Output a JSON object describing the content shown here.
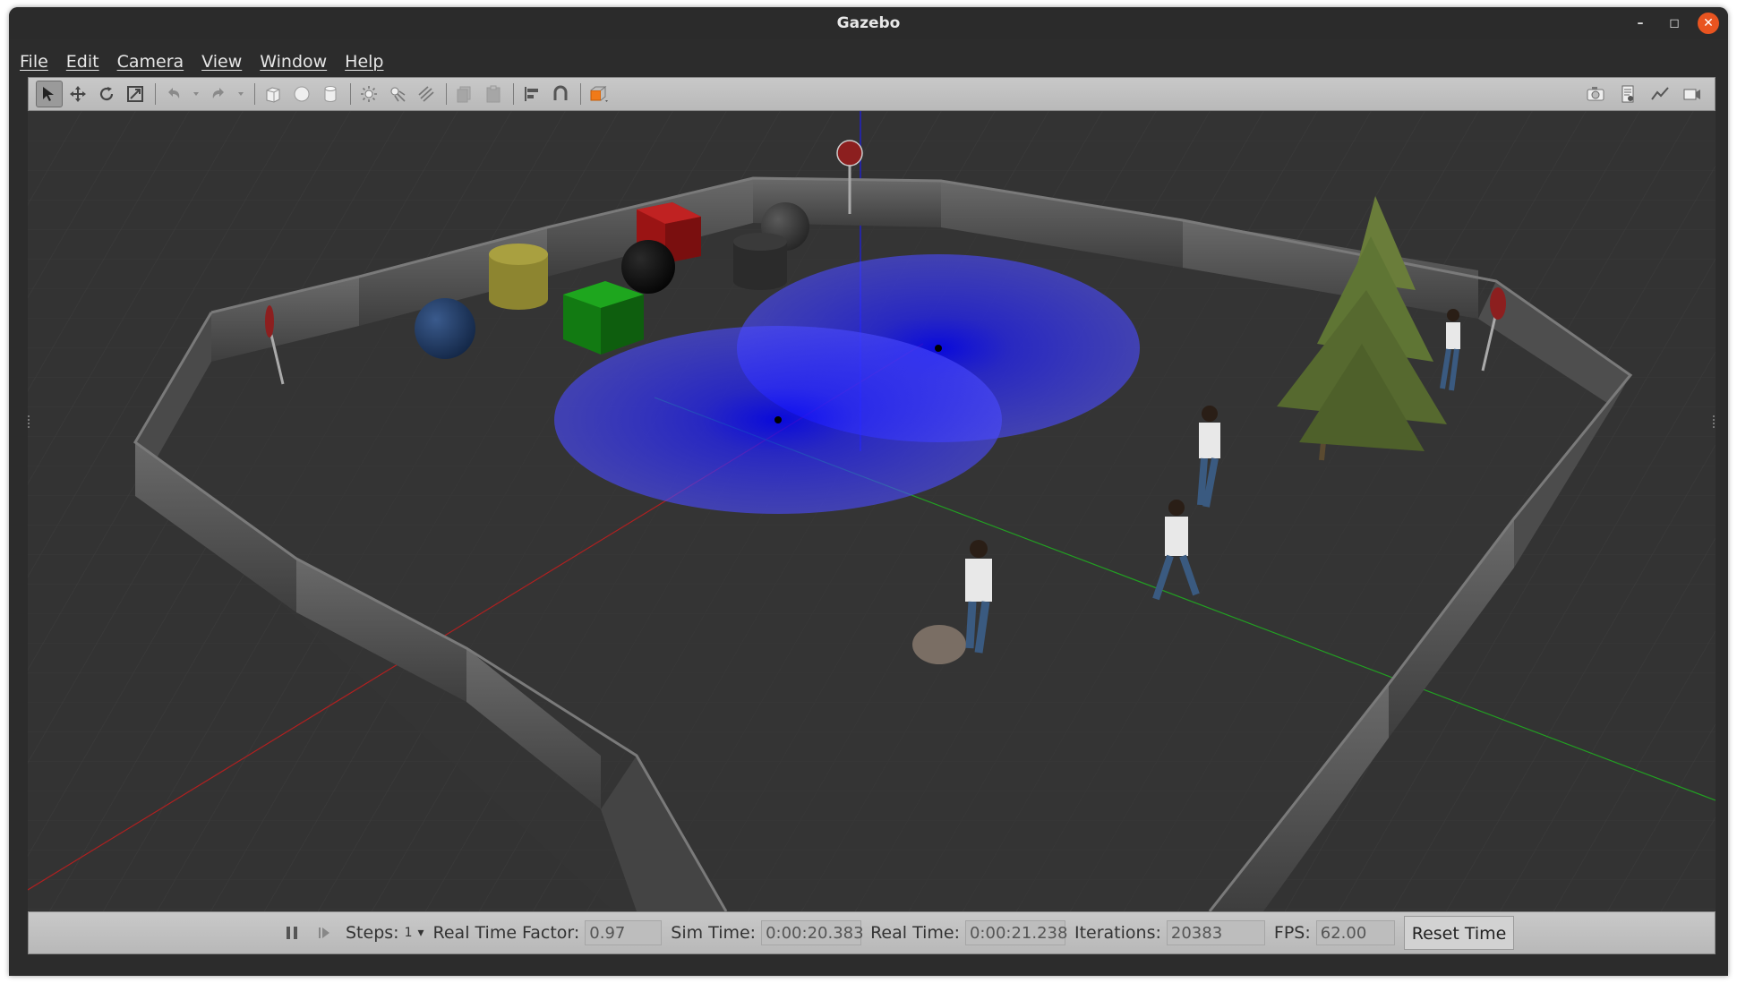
{
  "window": {
    "title": "Gazebo"
  },
  "menu": [
    "File",
    "Edit",
    "Camera",
    "View",
    "Window",
    "Help"
  ],
  "toolbar": {
    "left_icons": [
      "select-arrow-icon",
      "translate-icon",
      "rotate-icon",
      "scale-icon",
      "undo-icon",
      "undo-dropdown-icon",
      "redo-icon",
      "redo-dropdown-icon",
      "box-shape-icon",
      "sphere-shape-icon",
      "cylinder-shape-icon",
      "point-light-icon",
      "spot-light-icon",
      "directional-light-icon",
      "copy-icon",
      "paste-icon",
      "align-icon",
      "snap-icon",
      "view-angle-icon"
    ],
    "right_icons": [
      "screenshot-icon",
      "log-icon",
      "plot-icon",
      "record-video-icon"
    ]
  },
  "scene": {
    "description_objects": [
      "stop-sign",
      "box-red",
      "sphere-gray",
      "cylinder-yellow",
      "sphere-black",
      "cylinder-gray",
      "sphere-blue",
      "box-green",
      "tree",
      "person"
    ],
    "laser_color": "#2a2aff"
  },
  "status": {
    "steps_label": "Steps:",
    "steps_value": "1",
    "rtf_label": "Real Time Factor:",
    "rtf_value": "0.97",
    "sim_time_label": "Sim Time:",
    "sim_time_value": "0:00:20.383",
    "real_time_label": "Real Time:",
    "real_time_value": "0:00:21.238",
    "iterations_label": "Iterations:",
    "iterations_value": "20383",
    "fps_label": "FPS:",
    "fps_value": "62.00",
    "reset_label": "Reset Time"
  }
}
